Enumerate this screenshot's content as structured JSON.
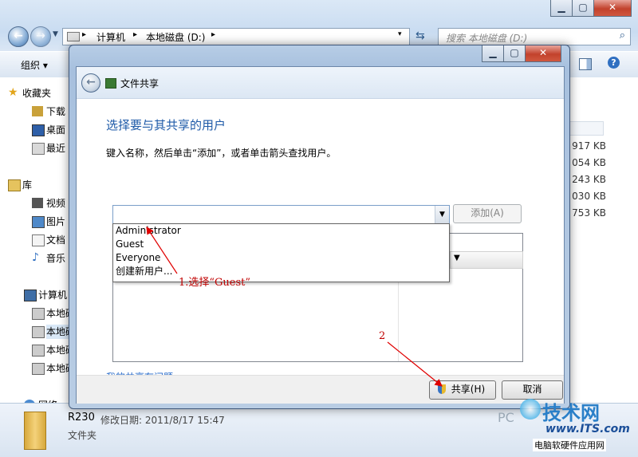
{
  "explorer": {
    "address": {
      "crumbs": [
        "计算机",
        "本地磁盘 (D:)"
      ]
    },
    "search_placeholder": "搜索 本地磁盘 (D:)",
    "toolbar": {
      "organize": "组织 ▾"
    },
    "nav": {
      "favorites": "收藏夹",
      "downloads": "下载",
      "desktop": "桌面",
      "recent": "最近",
      "libraries": "库",
      "videos": "视频",
      "pictures": "图片",
      "documents": "文档",
      "music": "音乐",
      "computer": "计算机",
      "disk1": "本地磁",
      "disk2": "本地磁",
      "disk3": "本地磁",
      "disk4": "本地磁",
      "network": "网络"
    },
    "sizes": [
      "917 KB",
      "054 KB",
      "243 KB",
      "030 KB",
      "753 KB"
    ],
    "details": {
      "name": "R230",
      "modified": "修改日期: 2011/8/17 15:47",
      "type": "文件夹"
    }
  },
  "dialog": {
    "title": "文件共享",
    "heading": "选择要与其共享的用户",
    "instruction": "键入名称，然后单击“添加”，或者单击箭头查找用户。",
    "combo_value": "",
    "add_button": "添加(A)",
    "dropdown_options": [
      "Administrator",
      "Guest",
      "Everyone",
      "创建新用户..."
    ],
    "trouble_link": "我的共享有问题",
    "share_button": "共享(H)",
    "cancel_button": "取消"
  },
  "annotations": {
    "step1": "1.选择“Guest”",
    "step2": "2"
  },
  "watermark": {
    "brand": "技术网",
    "url": "www.ITS.com",
    "tagline": "电脑软硬件应用网",
    "partial": "PC"
  },
  "colors": {
    "heading_blue": "#1e5aa8",
    "annotation_red": "#c00000",
    "link_blue": "#1e64c8"
  }
}
